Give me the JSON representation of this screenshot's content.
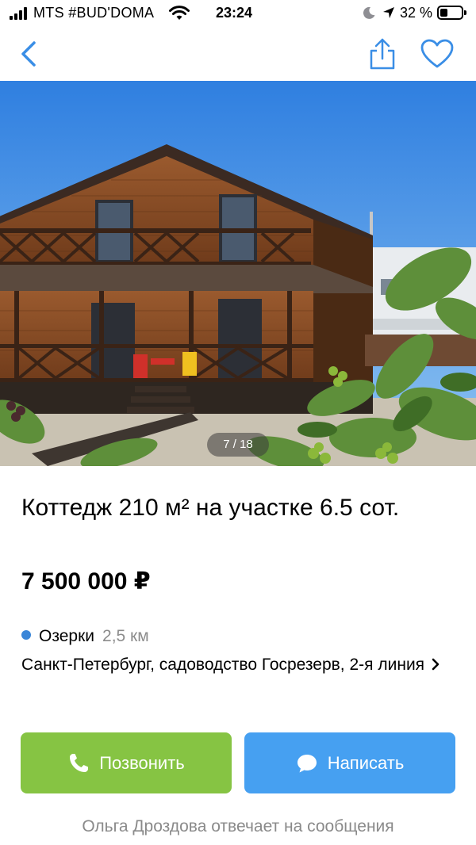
{
  "status_bar": {
    "carrier": "MTS #BUD'DOMA",
    "time": "23:24",
    "battery_percent": "32 %",
    "battery_level": 0.32
  },
  "nav": {
    "back_icon": "chevron-left-icon",
    "share_icon": "share-icon",
    "favorite_icon": "heart-icon",
    "accent_color": "#3a8ee6"
  },
  "gallery": {
    "counter": "7 / 18"
  },
  "listing": {
    "title": "Коттедж 210 м² на участке 6.5 сот.",
    "price": "7 500 000 ₽",
    "metro_station": "Озерки",
    "metro_distance": "2,5 км",
    "metro_color": "#3a86d8",
    "address": "Санкт-Петербург, садоводство Госрезерв, 2-я линия"
  },
  "actions": {
    "call_label": "Позвонить",
    "call_color": "#86c443",
    "write_label": "Написать",
    "write_color": "#46a0f1"
  },
  "footer": {
    "note": "Ольга Дроздова отвечает на сообщения"
  }
}
